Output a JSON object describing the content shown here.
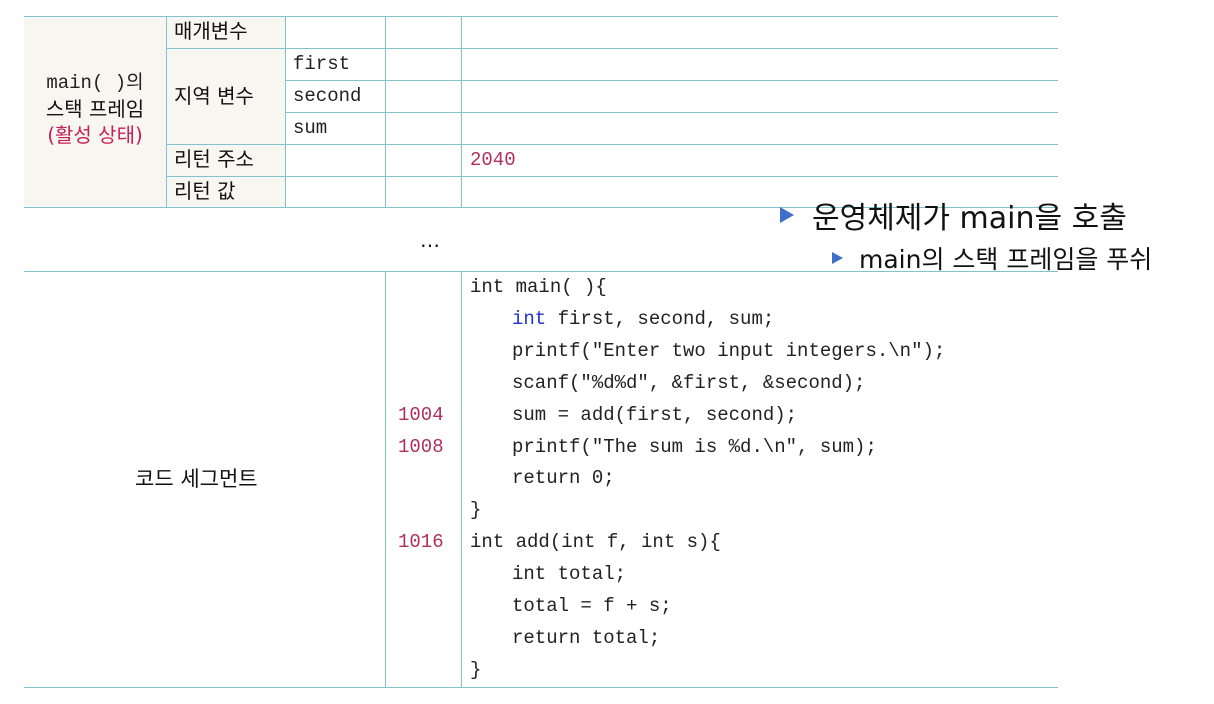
{
  "frame": {
    "label_line1": "main( )의",
    "label_line2": "스택 프레임",
    "label_line3": "(활성 상태)",
    "param_label": "매개변수",
    "local_label": "지역 변수",
    "locals": [
      "first",
      "second",
      "sum"
    ],
    "return_addr_label": "리턴 주소",
    "return_addr_value": "2040",
    "return_value_label": "리턴 값"
  },
  "ellipsis": "…",
  "notes": {
    "bullet1": "운영체제가 main을 호출",
    "bullet2": "main의 스택 프레임을 푸쉬"
  },
  "code_segment": {
    "label": "코드 세그먼트",
    "lines": [
      {
        "addr": "",
        "code": "int main( ){"
      },
      {
        "addr": "",
        "kw": "int",
        "code": " first, second, sum;"
      },
      {
        "addr": "",
        "code": "printf(\"Enter two input integers.\\n\");"
      },
      {
        "addr": "",
        "code": "scanf(\"%d%d\", &first, &second);"
      },
      {
        "addr": "1004",
        "code": "sum = add(first, second);"
      },
      {
        "addr": "1008",
        "code": "printf(\"The sum is %d.\\n\", sum);"
      },
      {
        "addr": "",
        "code": "return 0;"
      },
      {
        "addr": "",
        "code": "}"
      },
      {
        "addr": "1016",
        "code": "int add(int f, int s){"
      },
      {
        "addr": "",
        "code": "int total;"
      },
      {
        "addr": "",
        "code": "total = f + s;"
      },
      {
        "addr": "",
        "code": "return total;"
      },
      {
        "addr": "",
        "code": "}"
      }
    ]
  },
  "colors": {
    "grid": "#7fc4cf",
    "address": "#b0305a",
    "keyword": "#2233cc",
    "bullet": "#3f6fc8",
    "active_state": "#c8205a"
  }
}
